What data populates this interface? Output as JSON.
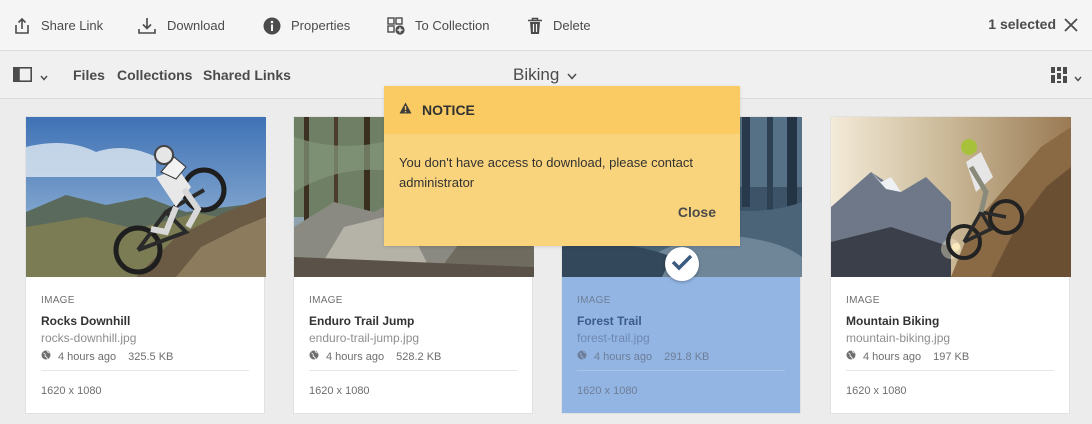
{
  "actionbar": {
    "share_label": "Share Link",
    "download_label": "Download",
    "properties_label": "Properties",
    "collection_label": "To Collection",
    "delete_label": "Delete",
    "selected_count": "1 selected"
  },
  "navbar": {
    "files": "Files",
    "collections": "Collections",
    "shared_links": "Shared Links",
    "folder": "Biking"
  },
  "cards": [
    {
      "type": "IMAGE",
      "title": "Rocks Downhill",
      "file": "rocks-downhill.jpg",
      "ago": "4 hours ago",
      "size": "325.5 KB",
      "dims": "1620 x 1080",
      "selected": false
    },
    {
      "type": "IMAGE",
      "title": "Enduro Trail Jump",
      "file": "enduro-trail-jump.jpg",
      "ago": "4 hours ago",
      "size": "528.2 KB",
      "dims": "1620 x 1080",
      "selected": false
    },
    {
      "type": "IMAGE",
      "title": "Forest Trail",
      "file": "forest-trail.jpg",
      "ago": "4 hours ago",
      "size": "291.8 KB",
      "dims": "1620 x 1080",
      "selected": true
    },
    {
      "type": "IMAGE",
      "title": "Mountain Biking",
      "file": "mountain-biking.jpg",
      "ago": "4 hours ago",
      "size": "197 KB",
      "dims": "1620 x 1080",
      "selected": false
    }
  ],
  "notice": {
    "title": "NOTICE",
    "message": "You don't have access to download, please contact administrator",
    "close_label": "Close"
  },
  "icons": {
    "share": "share-icon",
    "download": "download-icon",
    "properties": "info-icon",
    "collection": "add-to-collection-icon",
    "delete": "trash-icon",
    "close": "close-icon",
    "rail": "rail-toggle-icon",
    "view": "card-view-icon",
    "warning": "warning-icon",
    "globe": "globe-icon",
    "check": "checkmark-icon"
  },
  "colors": {
    "notice_bg": "#fad47c",
    "notice_header": "#f9cb62",
    "selected_card": "#93b5e3"
  }
}
